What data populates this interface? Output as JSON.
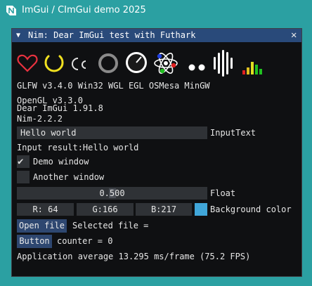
{
  "app": {
    "window_title": "ImGui / CImGui demo 2025",
    "accent": "#2ba0a2"
  },
  "imgui_window": {
    "title": "Nim: Dear ImGui test with Futhark",
    "collapse_icon": "▼",
    "close_icon": "✕",
    "title_bg": "#294a7a",
    "icons": [
      "heart-icon",
      "arc-spinner-icon",
      "double-arc-icon",
      "ring-icon",
      "clock-gauge-icon",
      "atom-icon",
      "dots-icon",
      "sound-bars-icon",
      "level-meter-icon"
    ]
  },
  "info": {
    "glfw": "GLFW v3.4.0 Win32 WGL EGL OSMesa MinGW",
    "opengl": "OpenGL v3.3.0",
    "imgui": "Dear ImGui 1.91.8",
    "nim": "Nim-2.2.2"
  },
  "input_text": {
    "value": "Hello world",
    "label": "InputText"
  },
  "input_result": "Input result:Hello world",
  "checkboxes": [
    {
      "label": "Demo window",
      "checked": true
    },
    {
      "label": "Another window",
      "checked": false
    }
  ],
  "float_slider": {
    "value": "0.500",
    "label": "Float",
    "fraction": 0.5
  },
  "color": {
    "r": "R: 64",
    "g": "G:166",
    "b": "B:217",
    "label": "Background color",
    "swatch": "#40a6d9"
  },
  "open_file": {
    "button": "Open file",
    "selected": "Selected file ="
  },
  "counter": {
    "button": "Button",
    "text": "counter = 0"
  },
  "stats": "Application average 13.295 ms/frame (75.2 FPS)"
}
